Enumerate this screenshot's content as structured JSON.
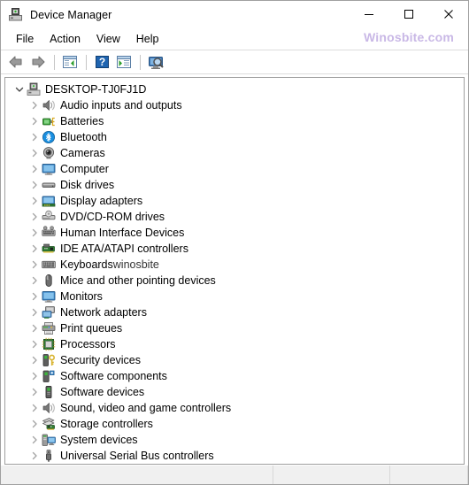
{
  "window": {
    "title": "Device Manager",
    "title_icon": "device-manager-icon",
    "controls": {
      "minimize": "minimize-icon",
      "maximize": "maximize-icon",
      "close": "close-icon"
    }
  },
  "watermark": {
    "top_right": "Winosbite.com"
  },
  "menubar": {
    "items": [
      {
        "label": "File"
      },
      {
        "label": "Action"
      },
      {
        "label": "View"
      },
      {
        "label": "Help"
      }
    ]
  },
  "toolbar": {
    "buttons": [
      {
        "name": "back-arrow-icon",
        "tip": "Back"
      },
      {
        "name": "forward-arrow-icon",
        "tip": "Forward"
      },
      {
        "name": "separator-1"
      },
      {
        "name": "show-hide-console-tree-icon",
        "tip": "Show/Hide Console Tree"
      },
      {
        "name": "separator-2"
      },
      {
        "name": "help-icon",
        "tip": "Help"
      },
      {
        "name": "properties-icon",
        "tip": "Properties"
      },
      {
        "name": "separator-3"
      },
      {
        "name": "scan-for-hardware-changes-icon",
        "tip": "Scan for hardware changes"
      }
    ]
  },
  "tree": {
    "root": {
      "label": "DESKTOP-TJ0FJ1D",
      "icon": "computer-icon",
      "expanded": true
    },
    "items": [
      {
        "label": "Audio inputs and outputs",
        "icon": "speaker-icon"
      },
      {
        "label": "Batteries",
        "icon": "battery-icon"
      },
      {
        "label": "Bluetooth",
        "icon": "bluetooth-icon"
      },
      {
        "label": "Cameras",
        "icon": "camera-icon"
      },
      {
        "label": "Computer",
        "icon": "monitor-icon"
      },
      {
        "label": "Disk drives",
        "icon": "disk-drive-icon"
      },
      {
        "label": "Display adapters",
        "icon": "display-adapter-icon"
      },
      {
        "label": "DVD/CD-ROM drives",
        "icon": "dvd-drive-icon"
      },
      {
        "label": "Human Interface Devices",
        "icon": "hid-icon"
      },
      {
        "label": "IDE ATA/ATAPI controllers",
        "icon": "ide-controller-icon"
      },
      {
        "label": "Keyboards",
        "icon": "keyboard-icon",
        "watermark": "winosbite"
      },
      {
        "label": "Mice and other pointing devices",
        "icon": "mouse-icon"
      },
      {
        "label": "Monitors",
        "icon": "monitor-icon"
      },
      {
        "label": "Network adapters",
        "icon": "network-adapter-icon"
      },
      {
        "label": "Print queues",
        "icon": "printer-icon"
      },
      {
        "label": "Processors",
        "icon": "processor-icon"
      },
      {
        "label": "Security devices",
        "icon": "security-device-icon"
      },
      {
        "label": "Software components",
        "icon": "software-component-icon"
      },
      {
        "label": "Software devices",
        "icon": "software-device-icon"
      },
      {
        "label": "Sound, video and game controllers",
        "icon": "speaker-icon"
      },
      {
        "label": "Storage controllers",
        "icon": "storage-controller-icon"
      },
      {
        "label": "System devices",
        "icon": "system-device-icon"
      },
      {
        "label": "Universal Serial Bus controllers",
        "icon": "usb-icon"
      }
    ]
  },
  "statusbar": {
    "panes": [
      "",
      "",
      ""
    ]
  },
  "colors": {
    "window_bg": "#ffffff",
    "menu_text": "#000000",
    "watermark": "#c9b8e6",
    "statusbar_bg": "#f0f0f0",
    "border": "#9f9f9f",
    "chevron": "#a0a0a0"
  }
}
